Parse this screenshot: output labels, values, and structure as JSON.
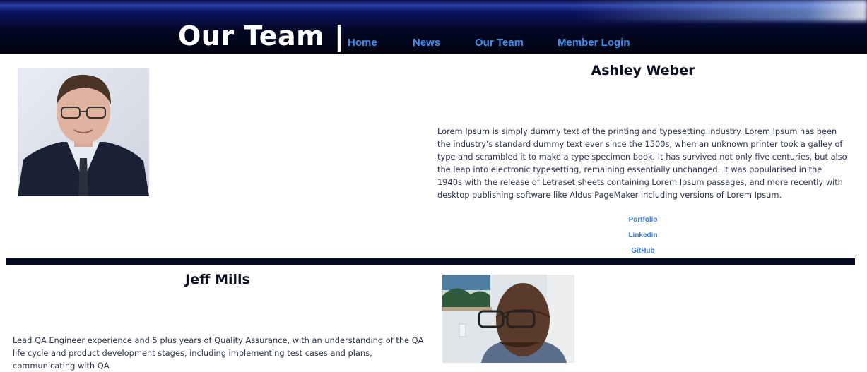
{
  "header": {
    "title": "Our Team |",
    "nav": [
      "Home",
      "News",
      "Our Team",
      "Member Login"
    ]
  },
  "members": [
    {
      "name": "Ashley Weber",
      "bio": "Lorem Ipsum is simply dummy text of the printing and typesetting industry. Lorem Ipsum has been the industry's standard dummy text ever since the 1500s, when an unknown printer took a galley of type and scrambled it to make a type specimen book. It has survived not only five centuries, but also the leap into electronic typesetting, remaining essentially unchanged. It was popularised in the 1940s with the release of Letraset sheets containing Lorem Ipsum passages, and more recently with desktop publishing software like Aldus PageMaker including versions of Lorem Ipsum.",
      "links": [
        "Portfolio",
        "Linkedin",
        "GitHub"
      ]
    },
    {
      "name": "Jeff Mills",
      "bio": "Lead QA Engineer experience and 5 plus years of Quality Assurance, with an understanding of the QA life cycle and product development stages, including implementing test cases and plans, communicating with QA"
    }
  ],
  "colors": {
    "nav_link": "#3b8ef0",
    "social_link": "#3b7fd6",
    "divider": "#030a24"
  }
}
